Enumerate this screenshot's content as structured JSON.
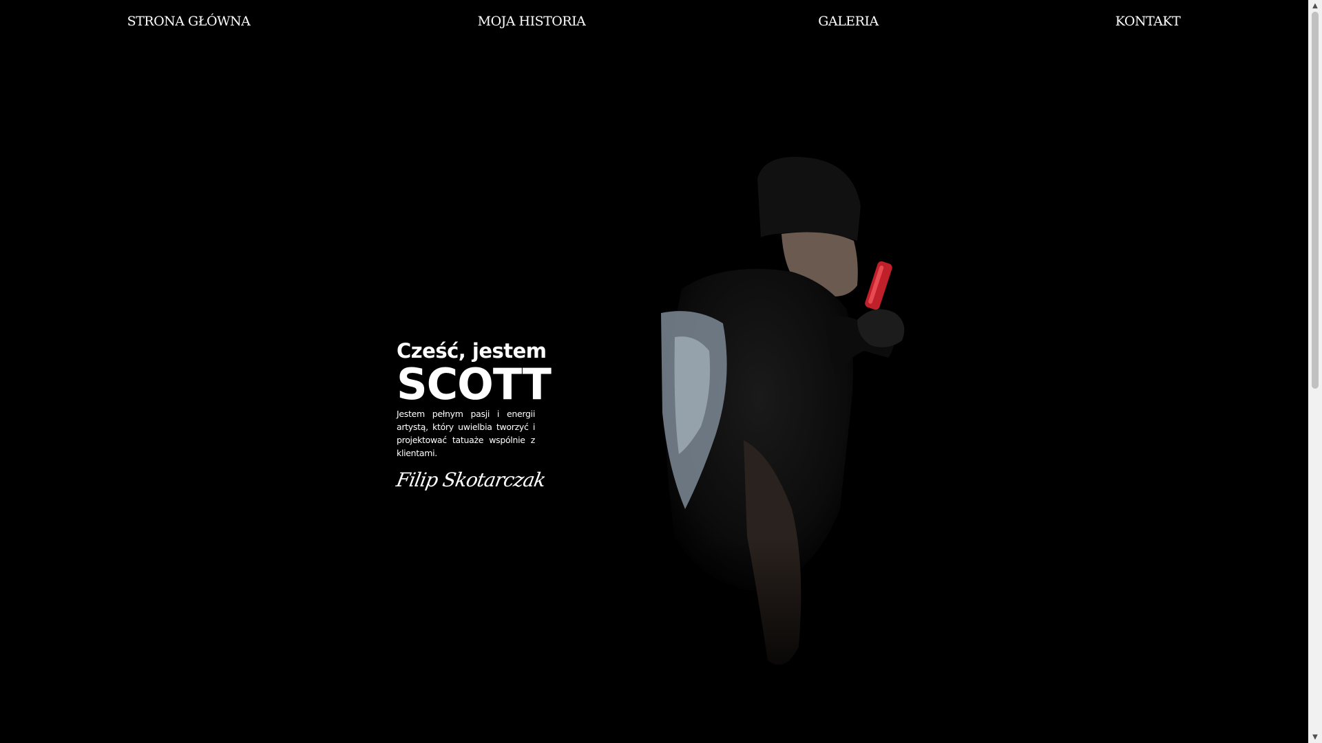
{
  "nav": {
    "items": [
      {
        "label": "STRONA GŁÓWNA"
      },
      {
        "label": "MOJA HISTORIA"
      },
      {
        "label": "GALERIA"
      },
      {
        "label": "KONTAKT"
      }
    ]
  },
  "hero": {
    "greeting": "Cześć, jestem",
    "name": "SCOTT",
    "bio": "Jestem pełnym pasji i energii artystą, który uwielbia tworzyć i projektować tatuaże wspólnie z klientami.",
    "signature": "Filip Skotarczak"
  },
  "colors": {
    "background": "#000000",
    "text": "#ffffff",
    "machine_accent": "#c0202a"
  },
  "icons": {
    "scroll_up": "triangle-up-icon",
    "scroll_down": "triangle-down-icon"
  }
}
